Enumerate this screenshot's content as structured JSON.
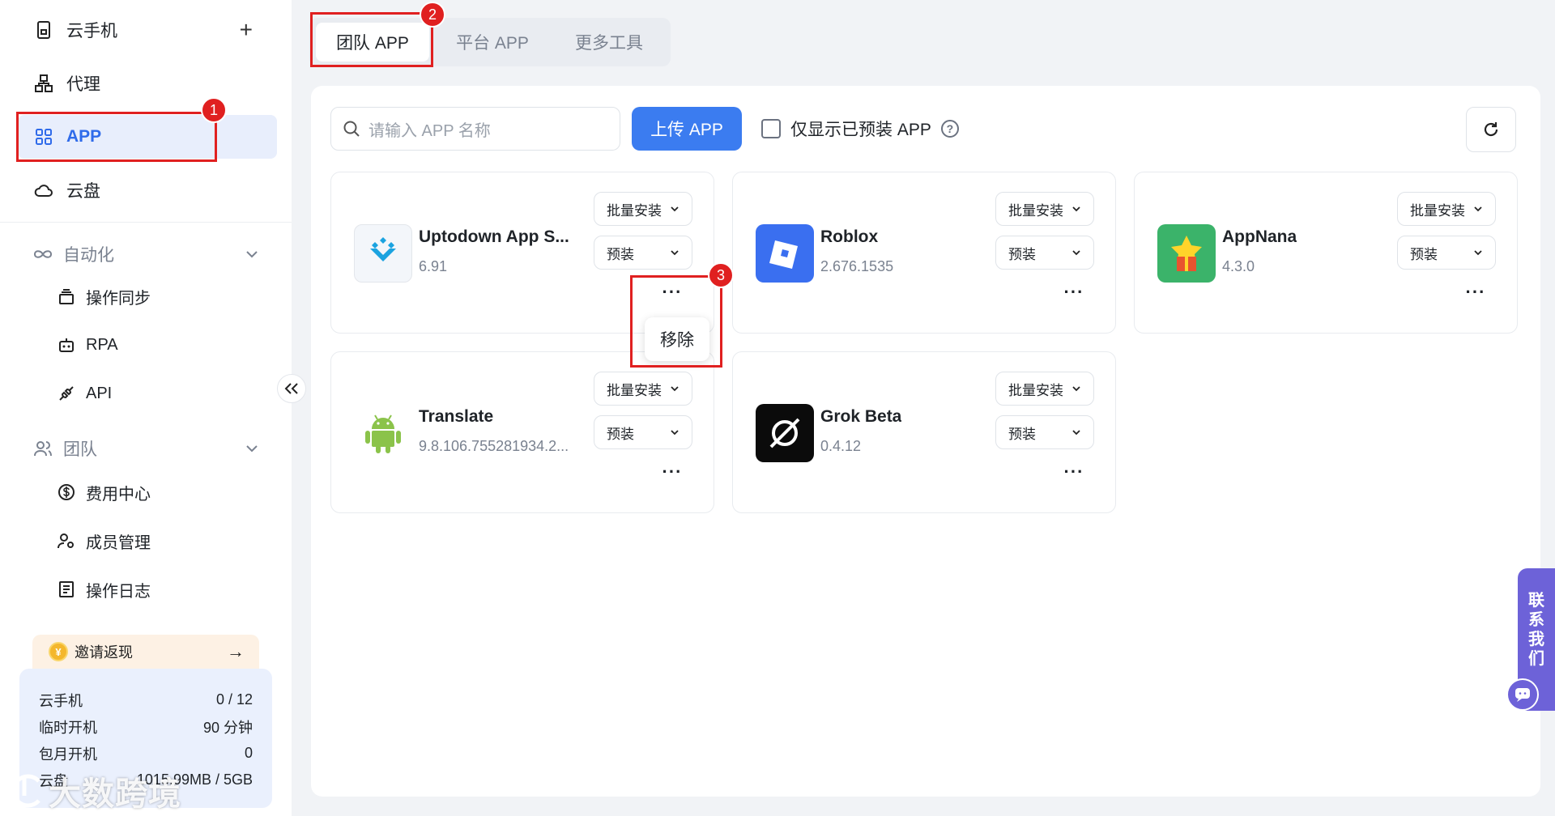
{
  "sidebar": {
    "items": [
      {
        "label": "云手机",
        "icon": "phone-icon"
      },
      {
        "label": "代理",
        "icon": "network-icon"
      },
      {
        "label": "APP",
        "icon": "grid-icon"
      },
      {
        "label": "云盘",
        "icon": "cloud-icon"
      }
    ],
    "automation": {
      "title": "自动化",
      "items": [
        {
          "label": "操作同步",
          "icon": "layers-icon"
        },
        {
          "label": "RPA",
          "icon": "robot-icon"
        },
        {
          "label": "API",
          "icon": "plug-icon"
        }
      ]
    },
    "team": {
      "title": "团队",
      "items": [
        {
          "label": "费用中心",
          "icon": "dollar-icon"
        },
        {
          "label": "成员管理",
          "icon": "user-gear-icon"
        },
        {
          "label": "操作日志",
          "icon": "log-icon"
        }
      ]
    },
    "invite": {
      "label": "邀请返现",
      "coin": "¥"
    },
    "quota": [
      {
        "label": "云手机",
        "value": "0 / 12"
      },
      {
        "label": "临时开机",
        "value": "90 分钟"
      },
      {
        "label": "包月开机",
        "value": "0"
      },
      {
        "label": "云盘",
        "value": "1015.99MB / 5GB"
      }
    ]
  },
  "tabs": [
    {
      "label": "团队 APP",
      "active": true
    },
    {
      "label": "平台 APP",
      "active": false
    },
    {
      "label": "更多工具",
      "active": false
    }
  ],
  "toolbar": {
    "search_placeholder": "请输入 APP 名称",
    "upload_label": "上传 APP",
    "checkbox_label": "仅显示已预装 APP",
    "help": "?"
  },
  "card_buttons": {
    "batch_install": "批量安装",
    "preinstall": "预装",
    "more": "···"
  },
  "apps": [
    {
      "name": "Uptodown App S...",
      "version": "6.91",
      "icon": "uptodown-icon"
    },
    {
      "name": "Roblox",
      "version": "2.676.1535",
      "icon": "roblox-icon"
    },
    {
      "name": "AppNana",
      "version": "4.3.0",
      "icon": "appnana-icon"
    },
    {
      "name": "Translate",
      "version": "9.8.106.755281934.2...",
      "icon": "android-icon"
    },
    {
      "name": "Grok Beta",
      "version": "0.4.12",
      "icon": "grok-icon"
    }
  ],
  "popup": {
    "remove_label": "移除"
  },
  "annotations": [
    "1",
    "2",
    "3"
  ],
  "contact": {
    "label": [
      "联",
      "系",
      "我",
      "们"
    ]
  },
  "watermark": "大数跨境",
  "colors": {
    "accent": "#3b7cf0",
    "highlight": "#e02020",
    "contact": "#6d62d8"
  }
}
